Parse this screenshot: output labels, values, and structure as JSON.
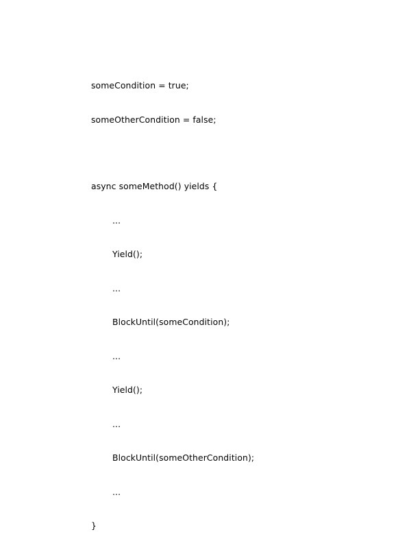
{
  "code": {
    "declarations": [
      "someCondition = true;",
      "someOtherCondition = false;"
    ],
    "method_signature": "async someMethod() yields {",
    "body_lines": [
      "...",
      "Yield();",
      "...",
      "BlockUntil(someCondition);",
      "...",
      "Yield();",
      "...",
      "BlockUntil(someOtherCondition);",
      "..."
    ],
    "closing_brace": "}"
  }
}
